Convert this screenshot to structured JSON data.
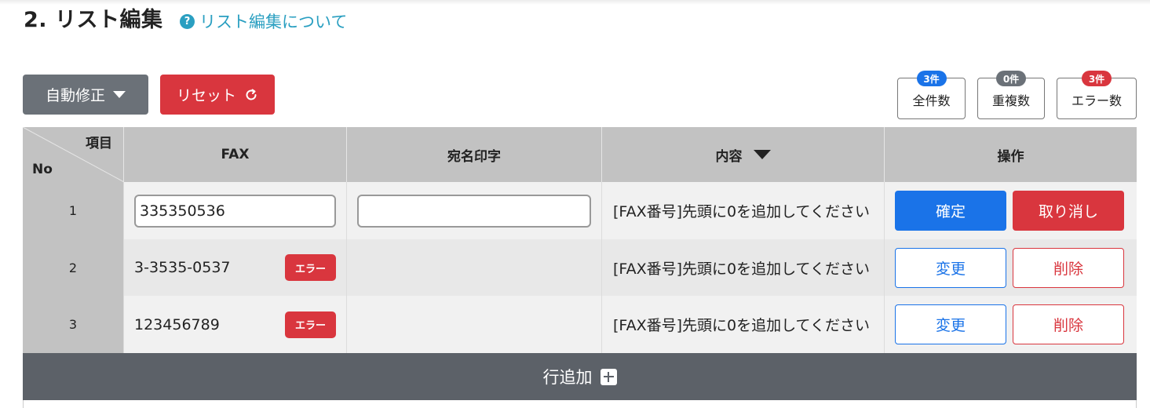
{
  "page": {
    "title": "2. リスト編集",
    "help_link": "リスト編集について",
    "help_icon": "question-circle-icon"
  },
  "toolbar": {
    "auto_fix_label": "自動修正",
    "reset_label": "リセット"
  },
  "counts": {
    "total": {
      "label": "全件数",
      "badge": "3件"
    },
    "duplicate": {
      "label": "重複数",
      "badge": "0件"
    },
    "error": {
      "label": "エラー数",
      "badge": "3件"
    }
  },
  "table": {
    "headers": {
      "item": "項目",
      "no": "No",
      "fax": "FAX",
      "name": "宛名印字",
      "content": "内容",
      "operation": "操作"
    },
    "rows": [
      {
        "no": "1",
        "fax": "335350536",
        "name": "",
        "content": "[FAX番号]先頭に0を追加してください",
        "editing": true,
        "primary": "確定",
        "secondary": "取り消し"
      },
      {
        "no": "2",
        "fax": "3-3535-0537",
        "error": "エラー",
        "content": "[FAX番号]先頭に0を追加してください",
        "editing": false,
        "primary": "変更",
        "secondary": "削除"
      },
      {
        "no": "3",
        "fax": "123456789",
        "error": "エラー",
        "content": "[FAX番号]先頭に0を追加してください",
        "editing": false,
        "primary": "変更",
        "secondary": "削除"
      }
    ]
  },
  "add_row": {
    "label": "行追加"
  },
  "colors": {
    "primary_blue": "#1a73e8",
    "danger_red": "#d9363e",
    "header_gray": "#c2c2c2",
    "dark_gray": "#5c6168",
    "link_teal": "#2a9fc1"
  }
}
